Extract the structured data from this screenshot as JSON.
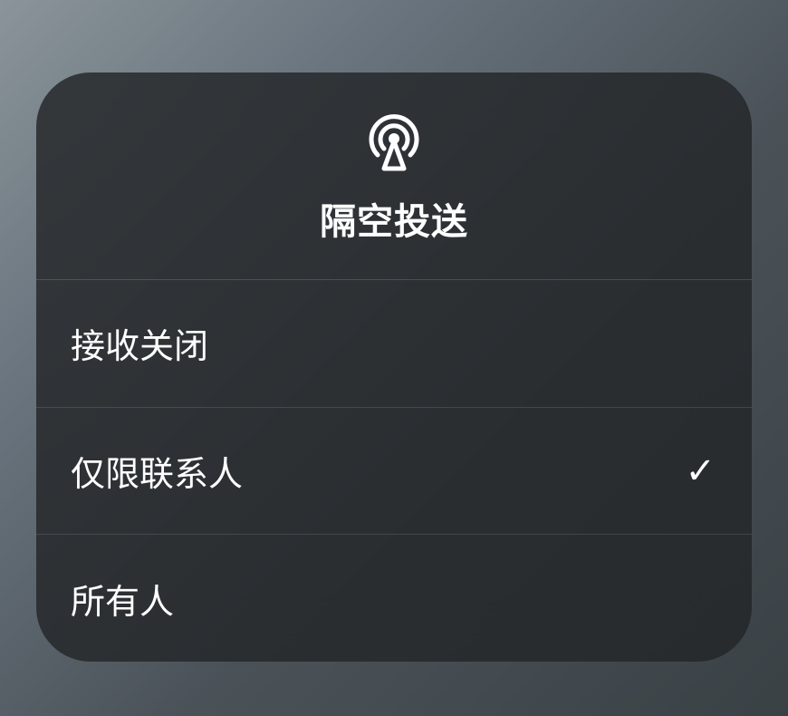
{
  "modal": {
    "title": "隔空投送",
    "icon": "airdrop-icon",
    "options": [
      {
        "label": "接收关闭",
        "selected": false
      },
      {
        "label": "仅限联系人",
        "selected": true
      },
      {
        "label": "所有人",
        "selected": false
      }
    ]
  }
}
